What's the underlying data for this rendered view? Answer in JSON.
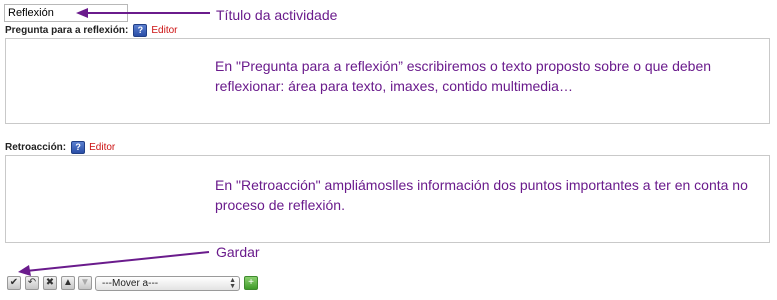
{
  "activity_title": {
    "value": "Reflexión",
    "annotation": "Título da actividade"
  },
  "question": {
    "label": "Pregunta para a reflexión:",
    "help_icon": "help-icon",
    "editor_link": "Editor",
    "annotation": "En \"Pregunta para a reflexión” escribiremos o texto proposto sobre o que deben reflexionar: área para texto, imaxes, contido multimedia…"
  },
  "feedback": {
    "label": "Retroacción:",
    "help_icon": "help-icon",
    "editor_link": "Editor",
    "annotation": "En \"Retroacción\" ampliámoslles información dos puntos importantes a ter en conta no proceso de reflexión."
  },
  "save_annotation": "Gardar",
  "toolbar": {
    "buttons": [
      {
        "icon": "checkmark-icon",
        "glyph": "✔"
      },
      {
        "icon": "undo-icon",
        "glyph": "↶"
      },
      {
        "icon": "delete-icon",
        "glyph": "✖"
      },
      {
        "icon": "move-up-icon",
        "glyph": "▲"
      },
      {
        "icon": "move-down-icon",
        "glyph": "▼"
      }
    ],
    "move_select": "---Mover a---",
    "go_icon": "add-icon"
  },
  "colors": {
    "annotation": "#6a1b8c",
    "editor_link": "#cc1111",
    "help_icon": "#2a4ea6"
  }
}
